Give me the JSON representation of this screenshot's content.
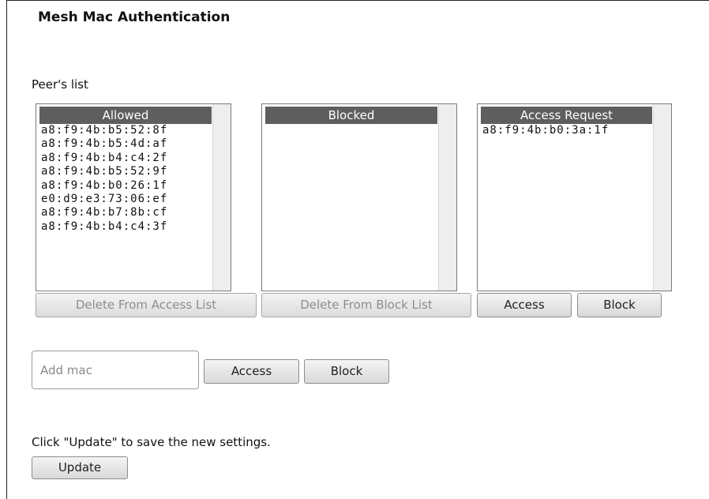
{
  "page": {
    "title": "Mesh Mac Authentication",
    "peers_label": "Peer's list"
  },
  "lists": {
    "allowed": {
      "header": "Allowed",
      "items": [
        "a8:f9:4b:b5:52:8f",
        "a8:f9:4b:b5:4d:af",
        "a8:f9:4b:b4:c4:2f",
        "a8:f9:4b:b5:52:9f",
        "a8:f9:4b:b0:26:1f",
        "e0:d9:e3:73:06:ef",
        "a8:f9:4b:b7:8b:cf",
        "a8:f9:4b:b4:c4:3f"
      ]
    },
    "blocked": {
      "header": "Blocked",
      "items": []
    },
    "access_request": {
      "header": "Access Request",
      "items": [
        "a8:f9:4b:b0:3a:1f"
      ]
    }
  },
  "buttons": {
    "delete_access": "Delete From Access List",
    "delete_block": "Delete From Block List",
    "request_access": "Access",
    "request_block": "Block",
    "add_access": "Access",
    "add_block": "Block",
    "update": "Update"
  },
  "add_mac": {
    "placeholder": "Add mac",
    "value": ""
  },
  "hint": "Click \"Update\" to save the new settings."
}
